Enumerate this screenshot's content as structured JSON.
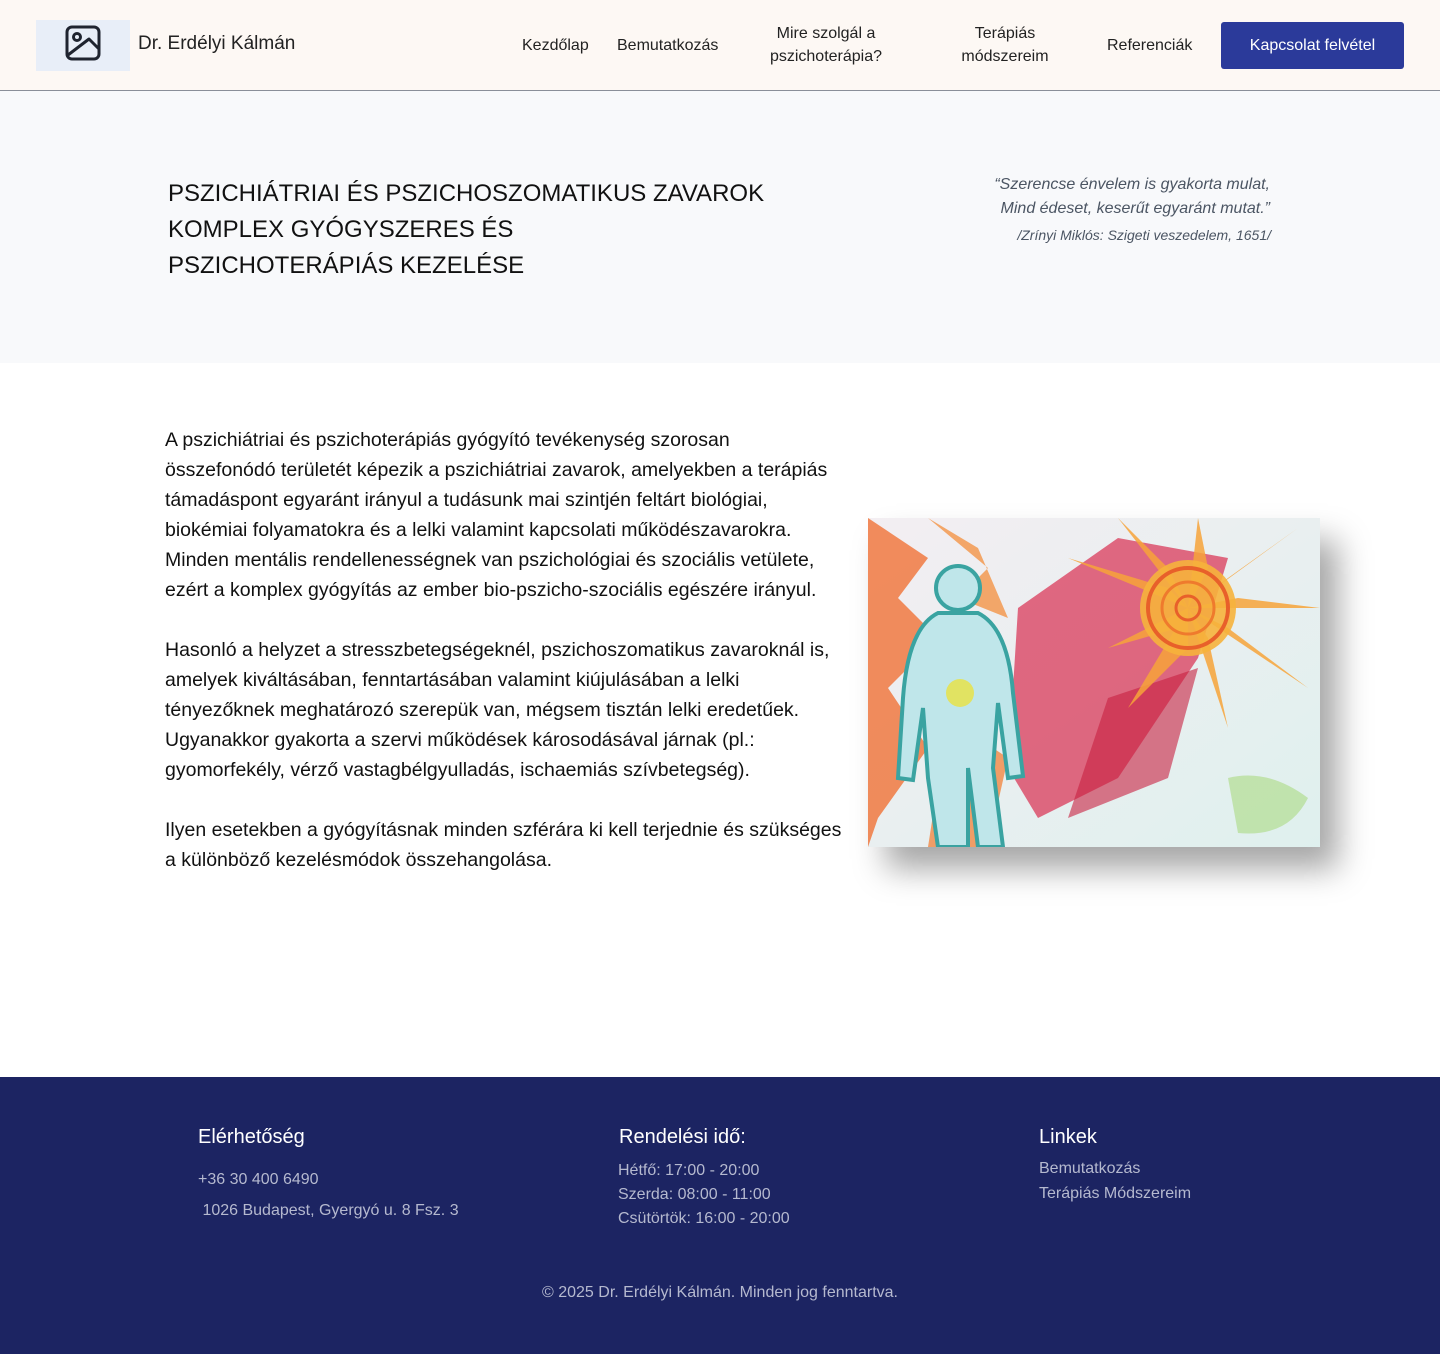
{
  "header": {
    "logo_icon": "image-placeholder-icon",
    "brand_name": "Dr. Erdélyi Kálmán",
    "nav": {
      "home": "Kezdőlap",
      "about": "Bemutatkozás",
      "what": "Mire szolgál a pszichoterápia?",
      "methods": "Terápiás módszereim",
      "references": "Referenciák"
    },
    "cta_label": "Kapcsolat felvétel",
    "accent_color": "#2b3a9a"
  },
  "hero": {
    "title_lines": [
      "PSZICHIÁTRIAI ÉS PSZICHOSZOMATIKUS ZAVAROK",
      "KOMPLEX GYÓGYSZERES ÉS",
      "PSZICHOTERÁPIÁS KEZELÉSE"
    ],
    "quote_lines": [
      "“Szerencse énvelem is gyakorta mulat,",
      "Mind édeset, keserűt egyaránt mutat.”"
    ],
    "quote_source": "/Zrínyi Miklós: Szigeti veszedelem, 1651/"
  },
  "main": {
    "paragraphs": [
      "A pszichiátriai és pszichoterápiás gyógyító tevékenység szorosan összefonódó területét képezik a pszichiátriai zavarok, amelyekben a terápiás támadáspont egyaránt irányul a tudásunk mai szintjén feltárt biológiai, biokémiai folyamatokra és a lelki valamint kapcsolati működészavarokra. Minden mentális rendellenességnek van pszichológiai és szociális vetülete, ezért a komplex gyógyítás az ember  bio-pszicho-szociális egészére irányul.",
      "Hasonló a helyzet a stresszbetegségeknél, pszichoszomatikus zavaroknál is, amelyek kiváltásában, fenntartásában valamint kiújulásában a lelki tényezőknek meghatározó szerepük van, mégsem tisztán lelki eredetűek. Ugyanakkor gyakorta a szervi működések károsodásával járnak (pl.: gyomorfekély, vérző vastagbélgyulladás, ischaemiás szívbetegség).",
      "Ilyen esetekben a gyógyításnak minden szférára ki kell terjednie és szükséges a különböző kezelésmódok összehangolása."
    ]
  },
  "footer": {
    "contact": {
      "heading": "Elérhetőség",
      "phone": "+36 30 400 6490",
      "address": " 1026 Budapest, Gyergyó u. 8 Fsz. 3"
    },
    "hours": {
      "heading": "Rendelési idő:",
      "lines": [
        "Hétfő: 17:00 - 20:00",
        "Szerda: 08:00 - 11:00",
        "Csütörtök: 16:00 - 20:00"
      ]
    },
    "links": {
      "heading": "Linkek",
      "items": [
        "Bemutatkozás",
        "Terápiás Módszereim"
      ]
    },
    "copyright": "© 2025 Dr. Erdélyi Kálmán. Minden jog fenntartva.",
    "background_color": "#1c2462"
  }
}
